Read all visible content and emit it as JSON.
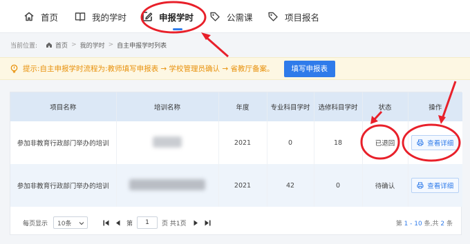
{
  "nav": {
    "items": [
      {
        "label": "首页",
        "icon": "home-icon"
      },
      {
        "label": "我的学时",
        "icon": "book-icon"
      },
      {
        "label": "申报学时",
        "icon": "edit-icon"
      },
      {
        "label": "公需课",
        "icon": "tag-icon"
      },
      {
        "label": "项目报名",
        "icon": "tag-icon"
      }
    ],
    "active_index": 2
  },
  "breadcrumb": {
    "prefix": "当前位置:",
    "items": [
      "首页",
      "我的学时",
      "自主申报学时列表"
    ],
    "separator": ">"
  },
  "tip": {
    "text": "提示:自主申报学时流程为:教师填写申报表 → 学校管理员确认 → 省教厅备案。",
    "button_label": "填写申报表"
  },
  "table": {
    "headers": [
      "项目名称",
      "培训名称",
      "年度",
      "专业科目学时",
      "选修科目学时",
      "状态",
      "操作"
    ],
    "rows": [
      {
        "project": "参加非教育行政部门举办的培训",
        "training": "",
        "year": "2021",
        "major_hours": "0",
        "elective_hours": "18",
        "status": "已退回",
        "action": "查看详细"
      },
      {
        "project": "参加非教育行政部门举办的培训",
        "training": "",
        "year": "2021",
        "major_hours": "42",
        "elective_hours": "0",
        "status": "待确认",
        "action": "查看详细"
      }
    ]
  },
  "pager": {
    "size_label": "每页显示",
    "size_value": "10条",
    "page_prefix": "第",
    "page_value": "1",
    "page_suffix": "页 共1页",
    "summary_pre": "第",
    "summary_range": "1 - 10",
    "summary_mid": "条,共",
    "summary_total": "2",
    "summary_post": "条"
  },
  "colors": {
    "primary": "#2f7bea",
    "tip_text": "#e8910c",
    "tip_bg": "#fdf7e3",
    "header_bg": "#dce8f6",
    "annotation_red": "#e8202a"
  }
}
